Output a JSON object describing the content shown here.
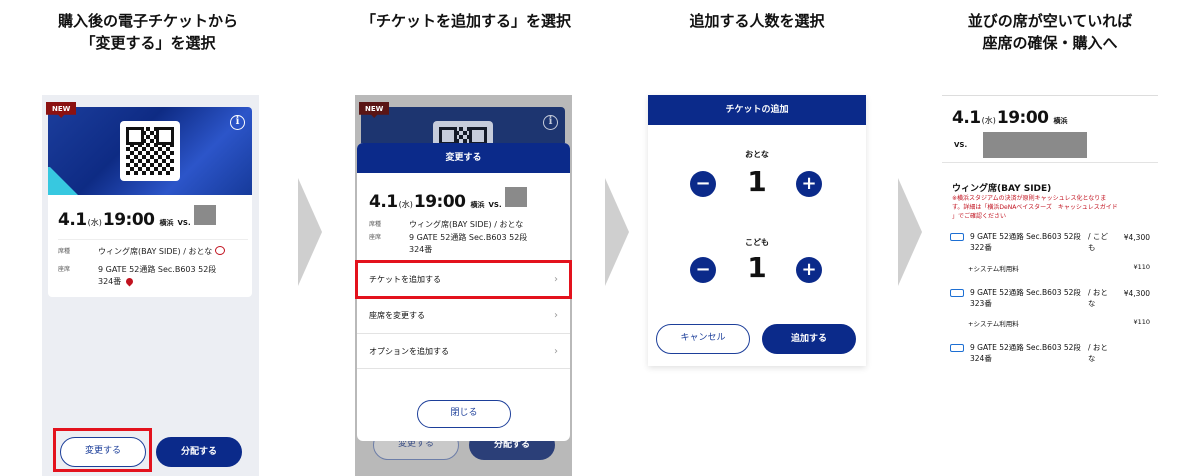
{
  "steps": [
    {
      "title_line1": "購入後の電子チケットから",
      "title_line2": "「変更する」を選択"
    },
    {
      "title_line1": "「チケットを追加する」を選択",
      "title_line2": ""
    },
    {
      "title_line1": "追加する人数を選択",
      "title_line2": ""
    },
    {
      "title_line1": "並びの席が空いていれば",
      "title_line2": "座席の確保・購入へ"
    }
  ],
  "ticket": {
    "new_badge": "NEW",
    "date_main": "4.1",
    "weekday": "(水)",
    "time": "19:00",
    "venue": "横浜",
    "vs": "VS.",
    "seat_type_label": "席種",
    "seat_type_value": "ウィング席(BAY SIDE) / おとな",
    "seat_label": "座席",
    "seat_value_line1": "9 GATE 52通路 Sec.B603 52段",
    "seat_value_line2": "324番",
    "info_symbol": "i"
  },
  "panel1": {
    "change_button": "変更する",
    "distribute_button": "分配する"
  },
  "panel2": {
    "modal_title": "変更する",
    "seat_type_value": "ウィング席(BAY SIDE) / おとな",
    "seat_value_line1": "9 GATE 52通路 Sec.B603 52段",
    "seat_value_line2": "324番",
    "menu": [
      "チケットを追加する",
      "座席を変更する",
      "オプションを追加する"
    ],
    "close_button": "閉じる",
    "bg_change_button": "変更する",
    "bg_distribute_button": "分配する"
  },
  "panel3": {
    "title": "チケットの追加",
    "adult_label": "おとな",
    "adult_count": "1",
    "child_label": "こども",
    "child_count": "1",
    "minus_symbol": "−",
    "plus_symbol": "+",
    "cancel_button": "キャンセル",
    "add_button": "追加する"
  },
  "panel4": {
    "date_main": "4.1",
    "weekday": "(水)",
    "time": "19:00",
    "venue": "横浜",
    "vs": "VS.",
    "seat_section": "ウィング席(BAY SIDE)",
    "notice_line1": "※横浜スタジアムの決済が原則キャッシュレス化となりま",
    "notice_line2": "す。詳細は「横浜DeNAベイスターズ　キャッシュレスガイド",
    "notice_line3": "」でご確認ください",
    "tickets": [
      {
        "line1": "9 GATE 52通路 Sec.B603 52段",
        "line2": "322番",
        "kind1": "/ こど",
        "kind2": "も",
        "price": "¥4,300",
        "fee_label": "+システム利用料",
        "fee": "¥110"
      },
      {
        "line1": "9 GATE 52通路 Sec.B603 52段",
        "line2": "323番",
        "kind1": "/ おと",
        "kind2": "な",
        "price": "¥4,300",
        "fee_label": "+システム利用料",
        "fee": "¥110"
      },
      {
        "line1": "9 GATE 52通路 Sec.B603 52段",
        "line2": "324番",
        "kind1": "/ おと",
        "kind2": "な",
        "price": "",
        "fee_label": "",
        "fee": ""
      }
    ]
  },
  "colors": {
    "brand_navy": "#0b2a8a",
    "highlight_red": "#e3121d",
    "notice_red": "#c1121f"
  }
}
